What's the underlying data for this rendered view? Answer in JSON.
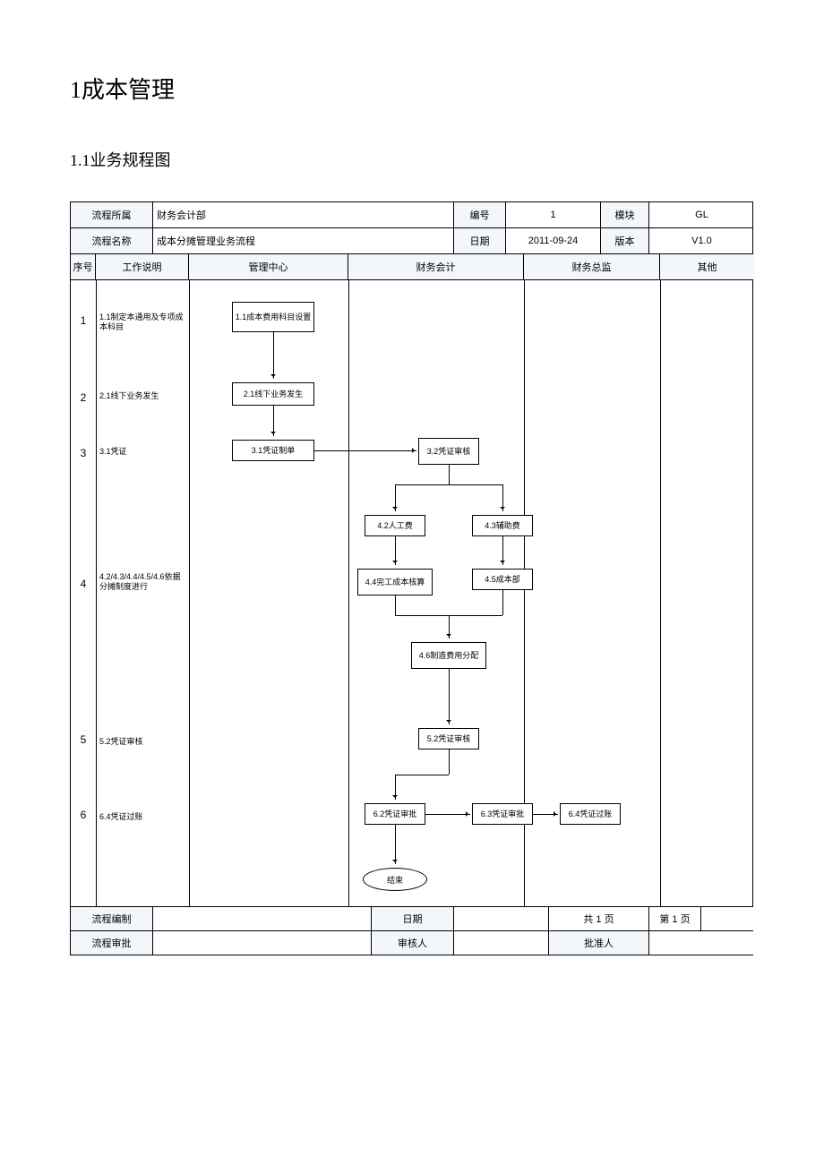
{
  "title": {
    "h1": "1成本管理",
    "h2": "1.1业务规程图"
  },
  "header": {
    "r1": {
      "c1": "流程所属",
      "c2": "财务会计部",
      "c3": "编号",
      "c4": "1",
      "c5": "模块",
      "c6": "GL"
    },
    "r2": {
      "c1": "流程名称",
      "c2": "成本分摊管理业务流程",
      "c3": "日期",
      "c4": "2011-09-24",
      "c5": "版本",
      "c6": "V1.0"
    }
  },
  "lanes": {
    "l0": "序号",
    "l1": "工作说明",
    "l2": "管理中心",
    "l3": "财务会计",
    "l4": "财务总监",
    "l5": "其他"
  },
  "steps": {
    "s1": {
      "num": "1",
      "desc": "1.1制定本通用及专项成本科目",
      "box": "1.1成本费用科目设置"
    },
    "s2": {
      "num": "2",
      "desc": "2.1线下业务发生",
      "box": "2.1线下业务发生"
    },
    "s3": {
      "num": "3",
      "desc": "3.1凭证",
      "box31": "3.1凭证制单",
      "box32": "3.2凭证审核"
    },
    "s4": {
      "num": "4",
      "desc": "4.2/4.3/4.4/4.5/4.6依据分摊制度进行",
      "box42": "4.2人工费",
      "box43": "4.3辅助费",
      "box44": "4.4完工成本核算",
      "box45": "4.5成本部",
      "box46": "4.6制造费用分配"
    },
    "s5": {
      "num": "5",
      "desc": "5.2凭证审核",
      "box52": "5.2凭证审核"
    },
    "s6": {
      "num": "6",
      "desc": "6.4凭证过账",
      "box62": "6.2凭证审批",
      "box63": "6.3凭证审批",
      "box64": "6.4凭证过账",
      "end": "结束"
    }
  },
  "footer": {
    "r1": {
      "c1": "流程编制",
      "c2": "",
      "c3": "日期",
      "c4": "",
      "c5": "共 1 页",
      "c6": "第 1 页",
      "c7": ""
    },
    "r2": {
      "c1": "流程审批",
      "c2": "",
      "c3": "审核人",
      "c4": "",
      "c5": "批准人",
      "c6": ""
    }
  }
}
